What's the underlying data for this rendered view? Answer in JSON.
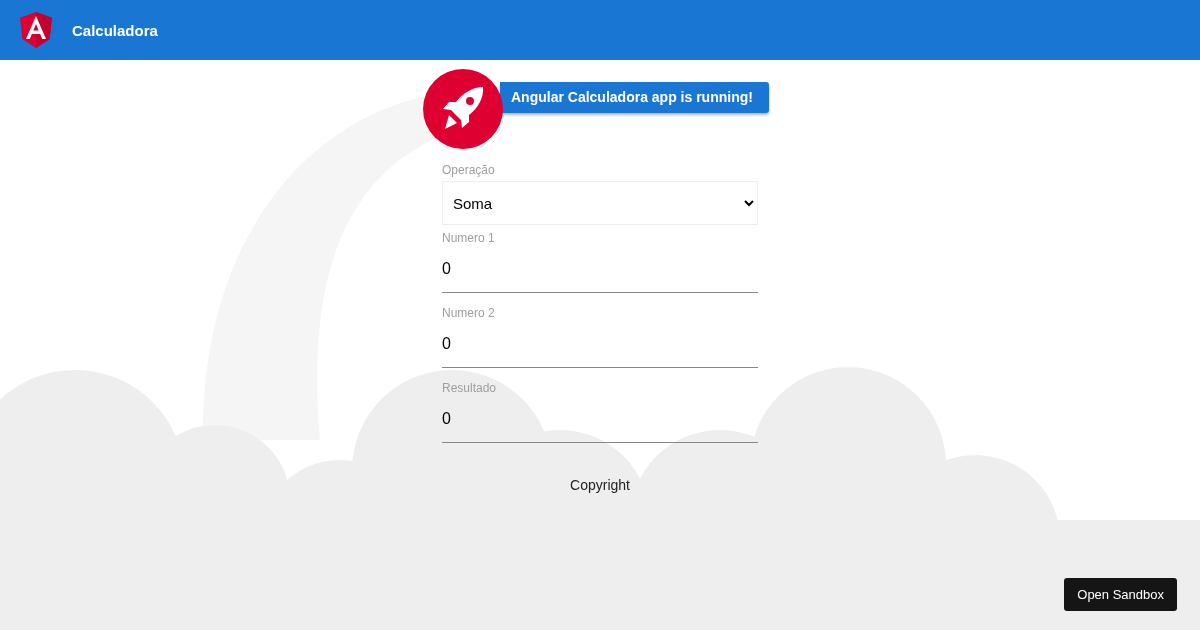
{
  "toolbar": {
    "title": "Calculadora"
  },
  "banner": {
    "text": "Angular Calculadora app is running!"
  },
  "form": {
    "fields": [
      {
        "kind": "select",
        "label": "Operação",
        "value": "Soma"
      },
      {
        "kind": "input",
        "label": "Numero 1",
        "value": "0"
      },
      {
        "kind": "input",
        "label": "Numero 2",
        "value": "0"
      },
      {
        "kind": "input",
        "label": "Resultado",
        "value": "0"
      }
    ]
  },
  "footer": {
    "text": "Copyright"
  },
  "sandbox_button": {
    "label": "Open Sandbox"
  }
}
